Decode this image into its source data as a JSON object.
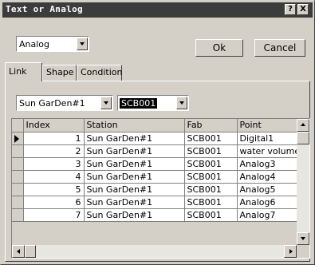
{
  "window": {
    "title": "Text or Analog",
    "help_glyph": "?",
    "close_glyph": "X"
  },
  "type_select": {
    "value": "Analog"
  },
  "buttons": {
    "ok": "Ok",
    "cancel": "Cancel"
  },
  "tabs": [
    {
      "label": "Link",
      "active": true
    },
    {
      "label": "Shape",
      "active": false
    },
    {
      "label": "Condition",
      "active": false
    }
  ],
  "station_select": {
    "value": "Sun GarDen#1"
  },
  "fab_select": {
    "value": "SCB001"
  },
  "table": {
    "columns": [
      "Index",
      "Station",
      "Fab",
      "Point"
    ],
    "rows": [
      {
        "index": "1",
        "station": "Sun GarDen#1",
        "fab": "SCB001",
        "point": "Digital1"
      },
      {
        "index": "2",
        "station": "Sun GarDen#1",
        "fab": "SCB001",
        "point": "water volume"
      },
      {
        "index": "3",
        "station": "Sun GarDen#1",
        "fab": "SCB001",
        "point": "Analog3"
      },
      {
        "index": "4",
        "station": "Sun GarDen#1",
        "fab": "SCB001",
        "point": "Analog4"
      },
      {
        "index": "5",
        "station": "Sun GarDen#1",
        "fab": "SCB001",
        "point": "Analog5"
      },
      {
        "index": "6",
        "station": "Sun GarDen#1",
        "fab": "SCB001",
        "point": "Analog6"
      },
      {
        "index": "7",
        "station": "Sun GarDen#1",
        "fab": "SCB001",
        "point": "Analog7"
      }
    ]
  },
  "colors": {
    "face": "#d4d0c8",
    "title_bar": "#3c3c3c",
    "selection": "#000000"
  }
}
